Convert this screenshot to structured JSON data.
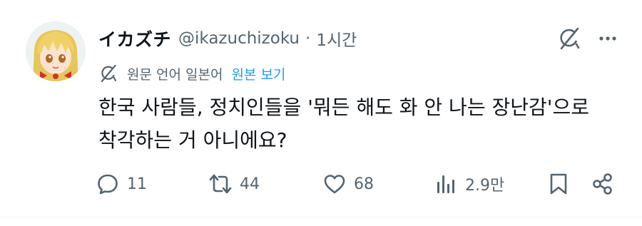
{
  "tweet": {
    "author": {
      "display_name": "イカズチ",
      "handle": "@ikazuchizoku",
      "avatar": "anime-character-avatar"
    },
    "separator": "·",
    "time": "1시간",
    "translation": {
      "label": "원문 언어 일본어",
      "link": "원본 보기",
      "icon": "grok-translate-icon"
    },
    "text": "한국 사람들, 정치인들을 '뭐든 해도 화 안 나는 장난감'으로 착각하는 거 아니에요?",
    "actions": {
      "reply_count": "11",
      "retweet_count": "44",
      "like_count": "68",
      "views_count": "2.9만"
    }
  },
  "colors": {
    "text_primary": "#0f1419",
    "text_secondary": "#536471",
    "link": "#1d9bf0",
    "divider": "#eff3f4"
  }
}
